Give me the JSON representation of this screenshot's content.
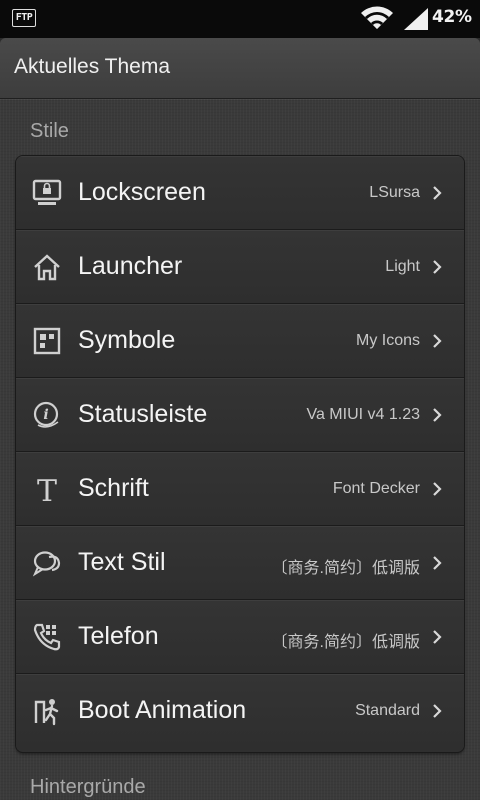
{
  "status_bar": {
    "ftp_label": "FTP",
    "battery": "42%"
  },
  "header": {
    "title": "Aktuelles Thema"
  },
  "sections": {
    "styles_label": "Stile",
    "backgrounds_label": "Hintergründe"
  },
  "items": [
    {
      "label": "Lockscreen",
      "value": "LSursa",
      "icon": "lockscreen-icon"
    },
    {
      "label": "Launcher",
      "value": "Light",
      "icon": "home-icon"
    },
    {
      "label": "Symbole",
      "value": "My Icons",
      "icon": "icons-grid-icon"
    },
    {
      "label": "Statusleiste",
      "value": "Va MIUI v4 1.23",
      "icon": "info-icon"
    },
    {
      "label": "Schrift",
      "value": "Font Decker",
      "icon": "font-icon"
    },
    {
      "label": "Text Stil",
      "value": "〔商务.简约〕低调版",
      "icon": "speech-bubble-icon"
    },
    {
      "label": "Telefon",
      "value": "〔商务.简约〕低调版",
      "icon": "phone-icon"
    },
    {
      "label": "Boot Animation",
      "value": "Standard",
      "icon": "boot-icon"
    }
  ],
  "colors": {
    "background": "#3a3a3a",
    "card": "#2f2f2f",
    "text": "#f4f4f4",
    "secondary_text": "#c8c8c8"
  }
}
